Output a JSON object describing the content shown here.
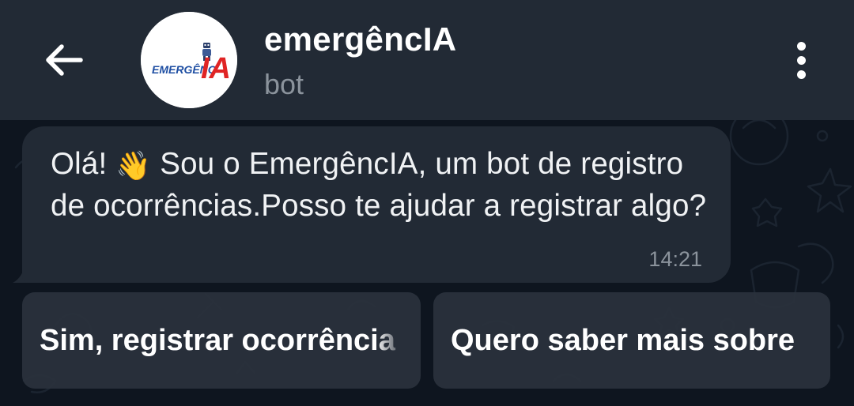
{
  "header": {
    "title": "emergêncIA",
    "subtitle": "bot",
    "back_icon": "arrow-left-icon",
    "menu_icon": "more-vertical-icon",
    "avatar": {
      "logo_text": "EMERGÊNC",
      "logo_accent": "IA",
      "accent_color": "#e02424",
      "text_color": "#1f4fa3"
    }
  },
  "message": {
    "text_before_emoji": "Olá! ",
    "emoji": "👋",
    "text_after_emoji": " Sou o EmergêncIA, um bot de registro de ocorrências.Posso te ajudar a registrar algo?",
    "time": "14:21"
  },
  "keyboard": {
    "buttons": [
      {
        "label": "Sim, registrar ocorrência"
      },
      {
        "label": "Quero saber mais sobre"
      }
    ]
  },
  "colors": {
    "header_bg": "#222a35",
    "chat_bg": "#0e151f",
    "bubble_bg": "#222a35",
    "muted_text": "#8b939c"
  }
}
